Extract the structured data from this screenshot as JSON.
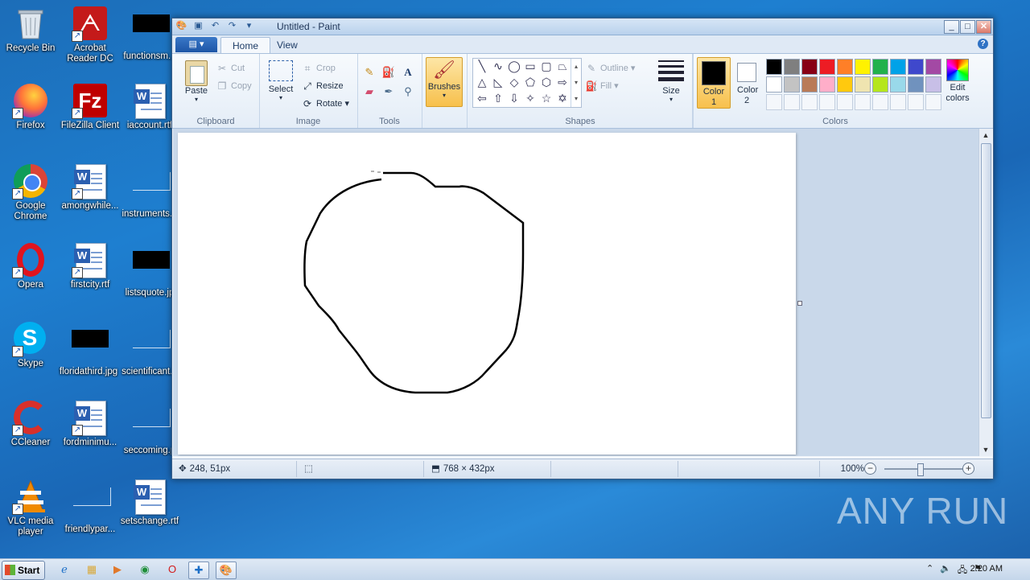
{
  "desktop": {
    "col1": [
      {
        "label": "Recycle Bin",
        "icon": "recycle-bin-icon"
      },
      {
        "label": "Acrobat Reader DC",
        "icon": "acrobat-icon"
      },
      {
        "label": "Firefox",
        "icon": "firefox-icon"
      },
      {
        "label": "FileZilla Client",
        "icon": "filezilla-icon"
      },
      {
        "label": "Google Chrome",
        "icon": "chrome-icon"
      },
      {
        "label": "Opera",
        "icon": "opera-icon"
      },
      {
        "label": "Skype",
        "icon": "skype-icon"
      },
      {
        "label": "CCleaner",
        "icon": "ccleaner-icon"
      },
      {
        "label": "VLC media player",
        "icon": "vlc-icon"
      }
    ],
    "col2": [
      {
        "label": "amongwhile...",
        "icon": "word-doc-icon"
      },
      {
        "label": "firstcity.rtf",
        "icon": "word-doc-icon"
      },
      {
        "label": "floridathird.jpg",
        "icon": "image-thumb-icon"
      },
      {
        "label": "fordminimu...",
        "icon": "word-doc-icon"
      },
      {
        "label": "friendlypar...",
        "icon": "blank-file-icon"
      }
    ],
    "col3": [
      {
        "label": "functionsm...",
        "icon": "image-thumb-icon"
      },
      {
        "label": "iaccount.rtf",
        "icon": "word-doc-icon"
      },
      {
        "label": "instruments...",
        "icon": "blank-file-icon"
      },
      {
        "label": "listsquote.jp",
        "icon": "image-thumb-icon"
      },
      {
        "label": "scientificant...",
        "icon": "blank-file-icon"
      },
      {
        "label": "seccoming.p",
        "icon": "blank-file-icon"
      },
      {
        "label": "setschange.rtf",
        "icon": "word-doc-icon"
      }
    ]
  },
  "window": {
    "title": "Untitled - Paint",
    "tabs": [
      "Home",
      "View"
    ],
    "clipboard": {
      "paste": "Paste",
      "cut": "Cut",
      "copy": "Copy",
      "group": "Clipboard"
    },
    "image": {
      "select": "Select",
      "crop": "Crop",
      "resize": "Resize",
      "rotate": "Rotate",
      "group": "Image"
    },
    "tools": {
      "group": "Tools"
    },
    "brushes": "Brushes",
    "shapes": {
      "outline": "Outline",
      "fill": "Fill",
      "group": "Shapes"
    },
    "size": "Size",
    "colors": {
      "color1": "Color 1",
      "color2": "Color 2",
      "edit": "Edit colors",
      "group": "Colors",
      "palette_row1": [
        "#000000",
        "#7f7f7f",
        "#880015",
        "#ed1c24",
        "#ff7f27",
        "#fff200",
        "#22b14c",
        "#00a2e8",
        "#3f48cc",
        "#a349a4"
      ],
      "palette_row2": [
        "#ffffff",
        "#c3c3c3",
        "#b97a57",
        "#ffaec9",
        "#ffc90e",
        "#efe4b0",
        "#b5e61d",
        "#99d9ea",
        "#7092be",
        "#c8bfe7"
      ]
    },
    "status": {
      "position": "248, 51px",
      "dimensions": "768 × 432px",
      "zoom": "100%"
    }
  },
  "taskbar": {
    "start": "Start",
    "time": "2:20 AM"
  },
  "watermark": "ANY RUN"
}
